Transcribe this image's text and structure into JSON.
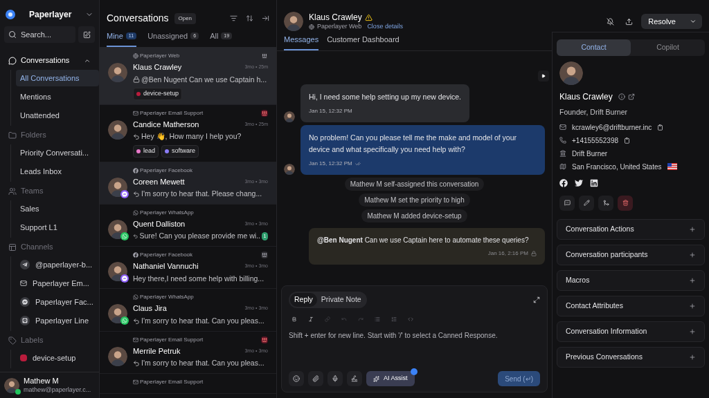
{
  "sidebar": {
    "workspace": "Paperlayer",
    "search": {
      "placeholder": "Search..."
    },
    "sections": [
      {
        "label": "Conversations",
        "collapsible": true,
        "children": [
          {
            "label": "All Conversations",
            "selected": true
          },
          {
            "label": "Mentions",
            "selected": false
          },
          {
            "label": "Unattended",
            "selected": false
          }
        ]
      },
      {
        "label": "Folders",
        "collapsible": false,
        "children": [
          {
            "label": "Priority Conversati...",
            "selected": false
          },
          {
            "label": "Leads Inbox",
            "selected": false
          }
        ]
      },
      {
        "label": "Teams",
        "collapsible": false,
        "children": [
          {
            "label": "Sales",
            "selected": false
          },
          {
            "label": "Support L1",
            "selected": false
          }
        ]
      },
      {
        "label": "Channels",
        "collapsible": false,
        "children": [
          {
            "label": "@paperlayer-b...",
            "selected": false,
            "kind": "telegram"
          },
          {
            "label": "Paperlayer Em...",
            "selected": false,
            "kind": "email"
          },
          {
            "label": "Paperlayer Fac...",
            "selected": false,
            "kind": "messenger"
          },
          {
            "label": "Paperlayer Line",
            "selected": false,
            "kind": "line"
          }
        ]
      },
      {
        "label": "Labels",
        "collapsible": false,
        "children": [
          {
            "label": "device-setup",
            "selected": false,
            "color": "#b91c3c"
          }
        ]
      }
    ],
    "user": {
      "name": "Mathew M",
      "email": "mathew@paperlayer.c...",
      "online": true
    }
  },
  "list": {
    "title": "Conversations",
    "status": "Open",
    "tabs": [
      {
        "label": "Mine",
        "count": "11",
        "selected": true
      },
      {
        "label": "Unassigned",
        "count": "6",
        "selected": false
      },
      {
        "label": "All",
        "count": "19",
        "selected": false
      }
    ],
    "items": [
      {
        "source": "Paperlayer Web",
        "kind": "web",
        "name": "Klaus Crawley",
        "time": "3mo • 25m",
        "preview": "@Ben Nugent Can we use Captain h...",
        "private": true,
        "replied": false,
        "flagged": true,
        "urgent": false,
        "labels": [
          {
            "text": "device-setup",
            "color": "#b91c3c"
          }
        ],
        "selected": true,
        "hovered": false
      },
      {
        "source": "Paperlayer Email Support",
        "kind": "email",
        "name": "Candice Matherson",
        "time": "3mo • 25m",
        "preview": "Hey 👋, How many I help you?",
        "private": false,
        "replied": true,
        "flagged": true,
        "urgent": true,
        "labels": [
          {
            "text": "lead",
            "color": "#e879c9"
          },
          {
            "text": "software",
            "color": "#8b7cf6"
          }
        ],
        "selected": false,
        "hovered": false
      },
      {
        "source": "Paperlayer Facebook",
        "kind": "facebook",
        "name": "Coreen Mewett",
        "time": "3mo • 3mo",
        "preview": "I'm sorry to hear that. Please chang...",
        "private": false,
        "replied": true,
        "flagged": false,
        "selected": false,
        "hovered": true
      },
      {
        "source": "Paperlayer WhatsApp",
        "kind": "whatsapp",
        "name": "Quent Dalliston",
        "time": "3mo • 3mo",
        "preview": "Sure! Can you please provide me wi..",
        "private": false,
        "replied": true,
        "flagged": false,
        "unread": "1",
        "selected": false,
        "hovered": false
      },
      {
        "source": "Paperlayer Facebook",
        "kind": "facebook",
        "name": "Nathaniel Vannuchi",
        "time": "3mo • 3mo",
        "preview": "Hey there,I need some help with billing...",
        "private": false,
        "replied": false,
        "flagged": true,
        "urgent": false,
        "selected": false,
        "hovered": false
      },
      {
        "source": "Paperlayer WhatsApp",
        "kind": "whatsapp",
        "name": "Claus Jira",
        "time": "3mo • 3mo",
        "preview": "I'm sorry to hear that. Can you pleas...",
        "private": false,
        "replied": true,
        "flagged": false,
        "selected": false,
        "hovered": false
      },
      {
        "source": "Paperlayer Email Support",
        "kind": "email",
        "name": "Merrile Petruk",
        "time": "3mo • 3mo",
        "preview": "I'm sorry to hear that. Can you pleas...",
        "private": false,
        "replied": true,
        "flagged": true,
        "urgent": true,
        "selected": false,
        "hovered": false
      },
      {
        "source": "Paperlayer Email Support",
        "kind": "email",
        "selected": false,
        "hovered": false
      }
    ]
  },
  "chat": {
    "name": "Klaus Crawley",
    "source": "Paperlayer Web",
    "close_link": "Close details",
    "resolve": "Resolve",
    "tabs": [
      {
        "label": "Messages",
        "selected": true
      },
      {
        "label": "Customer Dashboard",
        "selected": false
      }
    ],
    "messages": [
      {
        "kind": "incoming",
        "text": "Hi, I need some help setting up my new device.",
        "time": "Jan 15, 12:32 PM"
      },
      {
        "kind": "outgoing",
        "text": "No problem! Can you please tell me the make and model of your device and what specifically you need help with?",
        "time": "Jan 15, 12:32 PM"
      },
      {
        "kind": "activity",
        "text": "Mathew M self-assigned this conversation"
      },
      {
        "kind": "activity",
        "text": "Mathew M set the priority to high"
      },
      {
        "kind": "activity",
        "text": "Mathew M added device-setup"
      },
      {
        "kind": "note",
        "text": "**@Ben Nugent** Can we use Captain here to automate these queries?",
        "time": "Jan 16, 2:16 PM"
      }
    ],
    "composer": {
      "tabs": [
        {
          "label": "Reply",
          "selected": true
        },
        {
          "label": "Private Note",
          "selected": false
        }
      ],
      "placeholder": "Shift + enter for new line. Start with '/' to select a Canned Response.",
      "ai_button": "AI Assist",
      "send": "Send (↵)",
      "send_disabled": true
    }
  },
  "contact": {
    "tabs": [
      {
        "label": "Contact",
        "selected": true
      },
      {
        "label": "Copilot",
        "selected": false
      }
    ],
    "name": "Klaus Crawley",
    "title": "Founder, Drift Burner",
    "email": "kcrawley6@driftburner.inc",
    "phone": "+14155552398",
    "company": "Drift Burner",
    "location": "San Francisco, United States",
    "sections": [
      {
        "label": "Conversation Actions",
        "expanded": false
      },
      {
        "label": "Conversation participants",
        "expanded": false
      },
      {
        "label": "Macros",
        "expanded": false
      },
      {
        "label": "Contact Attributes",
        "expanded": false
      },
      {
        "label": "Conversation Information",
        "expanded": false
      },
      {
        "label": "Previous Conversations",
        "expanded": false
      }
    ]
  }
}
